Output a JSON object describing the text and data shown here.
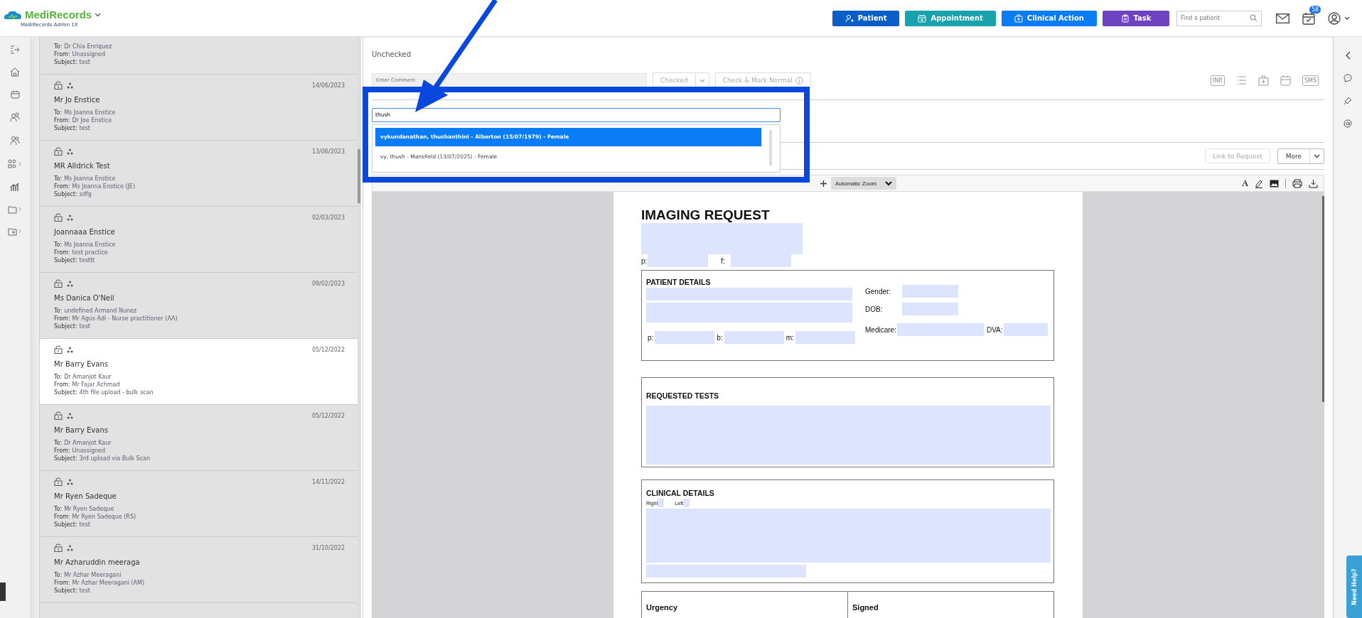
{
  "header": {
    "brand": "MediRecords",
    "account": "MediRecords Admin 1X",
    "search": {
      "placeholder": "Find a patient"
    },
    "tasks_badge": "58",
    "actions": [
      {
        "kind": "patient",
        "label": "Patient",
        "color": "#0a5ec8"
      },
      {
        "kind": "appointment",
        "label": "Appointment",
        "color": "#17a2ae"
      },
      {
        "kind": "clinical",
        "label": "Clinical Action",
        "color": "#0a7cf5"
      },
      {
        "kind": "task",
        "label": "Task",
        "color": "#6f42c1"
      }
    ]
  },
  "messages": [
    {
      "selected": false,
      "lines": [
        {
          "label": "To:",
          "value": "Dr Chia Enriquez"
        },
        {
          "label": "From:",
          "value": "Unassigned"
        },
        {
          "label": "Subject:",
          "value": "test"
        }
      ]
    },
    {
      "selected": false,
      "date": "14/06/2023",
      "name": "Mr Jo Enstice",
      "lines": [
        {
          "label": "To:",
          "value": "Ms Joanna Enstice"
        },
        {
          "label": "From:",
          "value": "Dr Joe Enstice"
        },
        {
          "label": "Subject:",
          "value": "test"
        }
      ]
    },
    {
      "selected": false,
      "date": "13/06/2023",
      "name": "MR Alldrick Test",
      "lines": [
        {
          "label": "To:",
          "value": "Ms Joanna Enstice"
        },
        {
          "label": "From:",
          "value": "Ms Joanna Enstice (JE)"
        },
        {
          "label": "Subject:",
          "value": "sdfg"
        }
      ]
    },
    {
      "selected": false,
      "date": "02/03/2023",
      "name": "Joannaaa Enstice",
      "lines": [
        {
          "label": "To:",
          "value": "Ms Joanna Enstice"
        },
        {
          "label": "From:",
          "value": "test practice"
        },
        {
          "label": "Subject:",
          "value": "testtt"
        }
      ]
    },
    {
      "selected": false,
      "date": "09/02/2023",
      "name": "Ms Danica O'Neil",
      "lines": [
        {
          "label": "To:",
          "value": "undefined Armand Nunez"
        },
        {
          "label": "From:",
          "value": "Mr Agus Adi - Nurse practitioner (AA)"
        },
        {
          "label": "Subject:",
          "value": "test"
        }
      ]
    },
    {
      "selected": true,
      "date": "05/12/2022",
      "name": "Mr Barry Evans",
      "lines": [
        {
          "label": "To:",
          "value": "Dr Amanjot Kaur"
        },
        {
          "label": "From:",
          "value": "Mr Fajar Achmad"
        },
        {
          "label": "Subject:",
          "value": "4th file upload - bulk scan"
        }
      ]
    },
    {
      "selected": false,
      "date": "05/12/2022",
      "name": "Mr Barry Evans",
      "lines": [
        {
          "label": "To:",
          "value": "Dr Amanjot Kaur"
        },
        {
          "label": "From:",
          "value": "Unassigned"
        },
        {
          "label": "Subject:",
          "value": "3rd upload via Bulk Scan"
        }
      ]
    },
    {
      "selected": false,
      "date": "14/11/2022",
      "name": "Mr Ryen Sadeque",
      "lines": [
        {
          "label": "To:",
          "value": "Mr Ryen Sadeque"
        },
        {
          "label": "From:",
          "value": "Mr Ryen Sadeque (RS)"
        },
        {
          "label": "Subject:",
          "value": "test"
        }
      ]
    },
    {
      "selected": false,
      "date": "31/10/2022",
      "name": "Mr Azharuddin meeraga",
      "lines": [
        {
          "label": "To:",
          "value": "Mr Azhar Meeragani"
        },
        {
          "label": "From:",
          "value": "Mr Azhar Meeragani (AM)"
        },
        {
          "label": "Subject:",
          "value": "test"
        }
      ]
    }
  ],
  "review": {
    "status": "Unchecked",
    "comment": {
      "placeholder": "Enter Comment"
    },
    "check_button": "Checked",
    "normal_button": "Check & Mark Normal",
    "tools": [
      {
        "kind": "inr",
        "label": "INR"
      },
      {
        "kind": "list"
      },
      {
        "kind": "medkit"
      },
      {
        "kind": "calendar"
      },
      {
        "kind": "sms",
        "label": "SMS"
      }
    ]
  },
  "patient_search": {
    "value": "thush",
    "results": [
      {
        "text": "vykundanathan, thushanthini - Alberton (15/07/1979) - Female",
        "selected": true
      },
      {
        "text": "vy, thush - Mansfield (13/07/2025) - Female",
        "selected": false
      }
    ]
  },
  "actions": {
    "link": {
      "label": "Link to Request",
      "disabled": true
    },
    "more": "More"
  },
  "viewer": {
    "zoom": "Automatic Zoom",
    "tools": [
      {
        "kind": "text",
        "label": "A"
      },
      {
        "kind": "draw"
      },
      {
        "kind": "image"
      },
      {
        "kind": "print"
      },
      {
        "kind": "download"
      }
    ]
  },
  "document": {
    "title": "IMAGING REQUEST",
    "phone": "p:",
    "fax": "f:",
    "patient": {
      "heading": "PATIENT DETAILS",
      "gender": "Gender:",
      "dob": "DOB:",
      "phone": "p:",
      "business": "b:",
      "mobile": "m:",
      "medicare": "Medicare:",
      "dva": "DVA:"
    },
    "tests": {
      "heading": "REQUESTED TESTS"
    },
    "clinical": {
      "heading": "CLINICAL DETAILS",
      "right": "Right",
      "left": "Left"
    },
    "footer": {
      "urgency": "Urgency",
      "signed": "Signed"
    }
  },
  "help": "Need Help?"
}
